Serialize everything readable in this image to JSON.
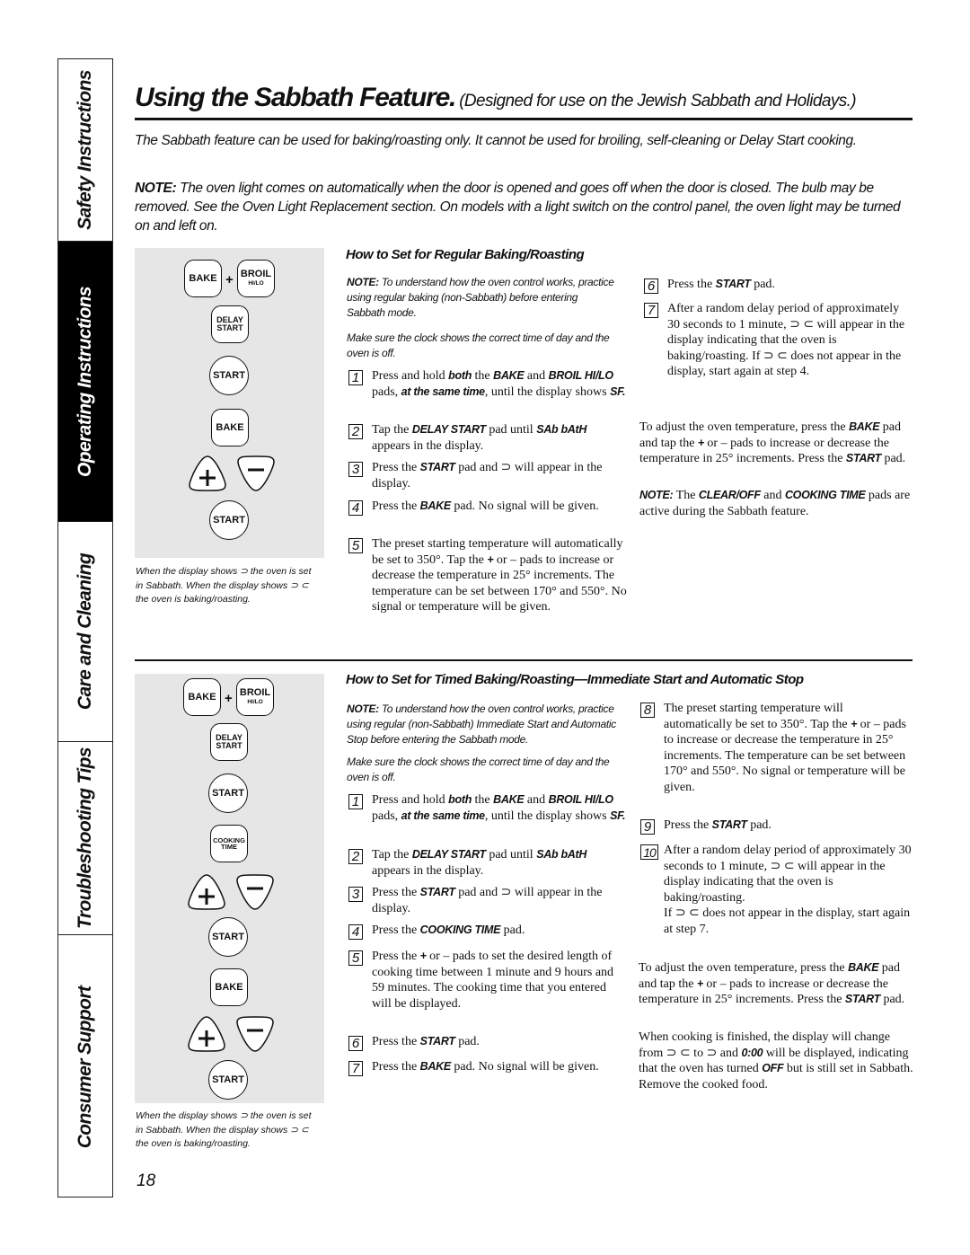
{
  "sidebar": {
    "tabs": [
      {
        "label": "Safety Instructions",
        "active": false
      },
      {
        "label": "Operating Instructions",
        "active": true
      },
      {
        "label": "Care and Cleaning",
        "active": false
      },
      {
        "label": "Troubleshooting Tips",
        "active": false
      },
      {
        "label": "Consumer Support",
        "active": false
      }
    ]
  },
  "header": {
    "title": "Using the Sabbath Feature.",
    "subtitle": "(Designed for use on the Jewish Sabbath and Holidays.)"
  },
  "intro": {
    "p1": "The Sabbath feature can be used for baking/roasting only. It cannot be used for broiling, self-cleaning or Delay Start cooking.",
    "note_label": "NOTE:",
    "note_text": " The oven light comes on automatically when the door is opened and goes off when the door is closed. The bulb may be removed. See the Oven Light Replacement section. On models with a light switch on the control panel, the oven light may be turned on and left on."
  },
  "pads": {
    "bake": "BAKE",
    "plus": "+",
    "broil": "BROIL",
    "hilo": "HI/LO",
    "delay": "DELAY",
    "start_word": "START",
    "start": "START",
    "cooking": "COOKING",
    "time": "TIME"
  },
  "caption": "When the display shows ⊃ the oven is set in Sabbath. When the display shows ⊃ ⊂ the oven is baking/roasting.",
  "regular": {
    "heading": "How to Set for Regular Baking/Roasting",
    "note_label": "NOTE:",
    "note_text": " To understand how the oven control works, practice using regular baking (non-Sabbath) before entering Sabbath mode.",
    "clock_note": "Make sure the clock shows the correct time of day and the oven is off.",
    "steps": [
      {
        "n": "1",
        "html": "Press and hold <b class='k'>both</b> the <b class='k'>BAKE</b> and <b class='k'>BROIL HI/LO</b> pads, <b class='k'>at the same time</b>, until the display shows <b class='k'>SF.</b>"
      },
      {
        "n": "2",
        "html": "Tap the <b class='k'>DELAY START</b> pad until <b class='k'>SAb bAtH</b> appears in the display."
      },
      {
        "n": "3",
        "html": "Press the <b class='k'>START</b> pad and ⊃ will appear in the display."
      },
      {
        "n": "4",
        "html": "Press the <b class='k'>BAKE</b> pad. No signal will be given."
      },
      {
        "n": "5",
        "html": "The preset starting temperature will automatically be set to 350°. Tap the <b class='k'>+</b> or – pads to increase or decrease the temperature in 25° increments. The temperature can be set between 170° and 550°. No signal or temperature will be given."
      },
      {
        "n": "6",
        "html": "Press the <b class='k'>START</b> pad."
      },
      {
        "n": "7",
        "html": "After a random delay period of approximately 30 seconds to 1 minute, ⊃ ⊂ will appear in the display indicating that the oven is baking/roasting. If ⊃ ⊂ does not appear in the display, start again at step 4."
      }
    ],
    "adjust_html": "To adjust the oven temperature, press the <b class='k'>BAKE</b> pad and tap the <b class='k'>+</b> or – pads to increase or decrease the temperature in 25° increments. Press the <b class='k'>START</b> pad.",
    "final_note_html": "<b class='k'>NOTE:</b> The <b class='k'>CLEAR/OFF</b> and <b class='k'>COOKING TIME</b> pads are active during the Sabbath feature."
  },
  "timed": {
    "heading": "How to Set for Timed Baking/Roasting—Immediate Start and Automatic Stop",
    "note_label": "NOTE:",
    "note_text": " To understand how the oven control works, practice using regular (non-Sabbath) Immediate Start and Automatic Stop before entering the Sabbath mode.",
    "clock_note": "Make sure the clock shows the correct time of day and the oven is off.",
    "steps": [
      {
        "n": "1",
        "html": "Press and hold <b class='k'>both</b> the <b class='k'>BAKE</b> and <b class='k'>BROIL HI/LO</b> pads, <b class='k'>at the same time</b>, until the display shows <b class='k'>SF.</b>"
      },
      {
        "n": "2",
        "html": "Tap the <b class='k'>DELAY START</b> pad until <b class='k'>SAb bAtH</b> appears in the display."
      },
      {
        "n": "3",
        "html": "Press the <b class='k'>START</b> pad and ⊃ will appear in the display."
      },
      {
        "n": "4",
        "html": "Press the <b class='k'>COOKING TIME</b> pad."
      },
      {
        "n": "5",
        "html": "Press the <b class='k'>+</b> or – pads to set the desired length of cooking time between 1 minute and 9 hours and 59 minutes. The cooking time that you entered will be displayed."
      },
      {
        "n": "6",
        "html": "Press the <b class='k'>START</b> pad."
      },
      {
        "n": "7",
        "html": "Press the <b class='k'>BAKE</b> pad. No signal will be given."
      },
      {
        "n": "8",
        "html": "The preset starting temperature will automatically be set to 350°. Tap the <b class='k'>+</b> or – pads to increase or decrease the temperature in 25° increments. The temperature can be set between 170° and 550°. No signal or temperature will be given."
      },
      {
        "n": "9",
        "html": "Press the <b class='k'>START</b> pad."
      },
      {
        "n": "10",
        "html": "After a random delay period of approximately 30 seconds to 1 minute, ⊃ ⊂ will appear in the display indicating that the oven is baking/roasting.<br>If ⊃ ⊂ does not appear in the display, start again at step 7."
      }
    ],
    "adjust_html": "To adjust the oven temperature, press the <b class='k'>BAKE</b> pad and tap the <b class='k'>+</b> or – pads to increase or decrease the temperature in 25° increments. Press the <b class='k'>START</b> pad.",
    "finish_html": "When cooking is finished, the display will change from ⊃ ⊂ to ⊃ and <b class='k'>0:00</b> will be displayed, indicating that the oven has turned <b class='k'>OFF</b> but is still set in Sabbath. Remove the cooked food."
  },
  "page_number": "18"
}
